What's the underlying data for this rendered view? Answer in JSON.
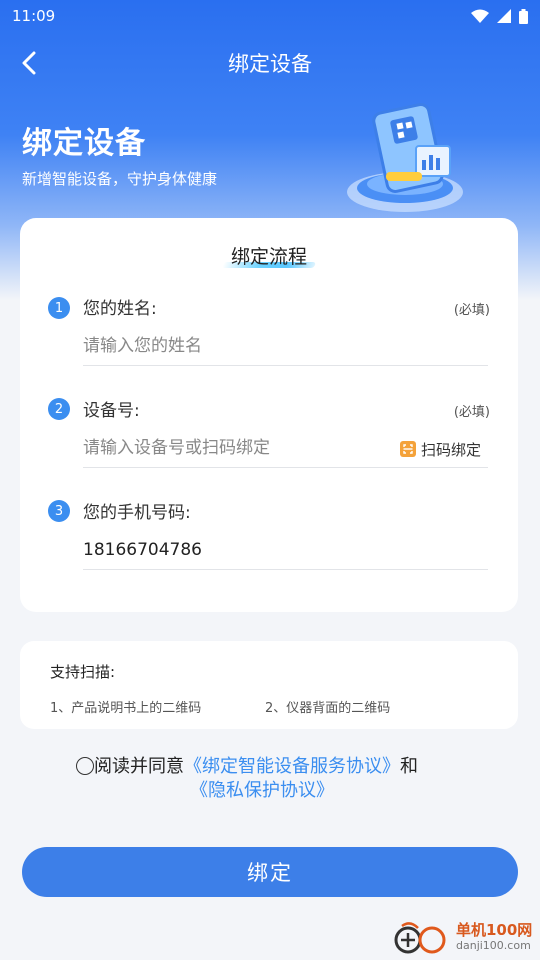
{
  "status_bar": {
    "time": "11:09"
  },
  "nav": {
    "title": "绑定设备"
  },
  "hero": {
    "title": "绑定设备",
    "subtitle": "新增智能设备，守护身体健康"
  },
  "card": {
    "heading": "绑定流程",
    "steps": [
      {
        "number": "1",
        "label": "您的姓名:",
        "required": "(必填)",
        "value": "",
        "placeholder": "请输入您的姓名"
      },
      {
        "number": "2",
        "label": "设备号:",
        "required": "(必填)",
        "value": "",
        "placeholder": "请输入设备号或扫码绑定",
        "scan_label": "扫码绑定"
      },
      {
        "number": "3",
        "label": "您的手机号码:",
        "value": "18166704786",
        "placeholder": ""
      }
    ]
  },
  "support": {
    "title": "支持扫描:",
    "items": [
      "1、产品说明书上的二维码",
      "2、仪器背面的二维码"
    ]
  },
  "agreement": {
    "prefix": "阅读并同意",
    "link1": "《绑定智能设备服务协议》",
    "connector": "和",
    "link2": "《隐私保护协议》"
  },
  "submit": {
    "label": "绑定"
  },
  "watermark": {
    "cn": "单机100网",
    "url": "danji100.com"
  },
  "colors": {
    "primary": "#3d7fe8",
    "accent_orange": "#f4a23a",
    "link": "#3b8ef0"
  }
}
